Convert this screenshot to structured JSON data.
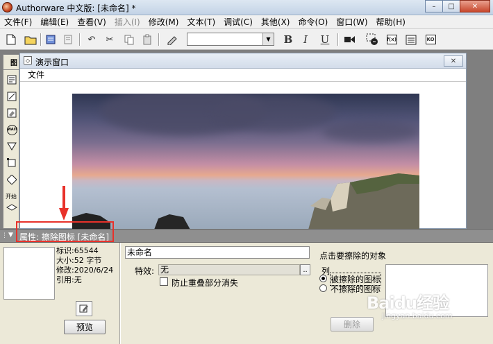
{
  "window": {
    "title": "Authorware 中文版: [未命名] *",
    "controls": {
      "minimize": "–",
      "maximize": "□",
      "close": "✕"
    }
  },
  "menubar": {
    "items": [
      {
        "label": "文件(F)",
        "enabled": true
      },
      {
        "label": "编辑(E)",
        "enabled": true
      },
      {
        "label": "查看(V)",
        "enabled": true
      },
      {
        "label": "插入(I)",
        "enabled": false
      },
      {
        "label": "修改(M)",
        "enabled": true
      },
      {
        "label": "文本(T)",
        "enabled": true
      },
      {
        "label": "调试(C)",
        "enabled": true
      },
      {
        "label": "其他(X)",
        "enabled": true
      },
      {
        "label": "命令(O)",
        "enabled": true
      },
      {
        "label": "窗口(W)",
        "enabled": true
      },
      {
        "label": "帮助(H)",
        "enabled": true
      }
    ]
  },
  "toolbar": {
    "bold": "B",
    "italic": "I",
    "underline": "U",
    "font_combo_value": "",
    "fx_label": "f(x)",
    "ko_label": "KO"
  },
  "icon_palette": {
    "header": "图",
    "wait_label": "WAIT",
    "start_label": "开始"
  },
  "presentation_window": {
    "title": "演示窗口",
    "menu_file": "文件",
    "close_glyph": "✕"
  },
  "properties": {
    "header": "属性: 擦除图标 [未命名]",
    "info": {
      "id": "标识:65544",
      "size": "大小:52 字节",
      "modified": "修改:2020/6/24",
      "reference": "引用:无"
    },
    "preview_button": "预览",
    "name": "未命名",
    "effect_label": "特效:",
    "effect_value": "无",
    "effect_browse": "..",
    "prevent_overlap_label": "防止重叠部分消失",
    "prevent_overlap_checked": false,
    "click_target_label": "点击要擦除的对象",
    "list_label": "列",
    "radio_options": [
      {
        "label": "被擦除的图标",
        "selected": true
      },
      {
        "label": "不擦除的图标",
        "selected": false
      }
    ],
    "delete_button": "删除"
  },
  "watermark": {
    "main": "Baidu经验",
    "sub": "jingyan.baidu.com"
  },
  "colors": {
    "highlight": "#e8312a",
    "props_header": "#8f8f8f"
  }
}
